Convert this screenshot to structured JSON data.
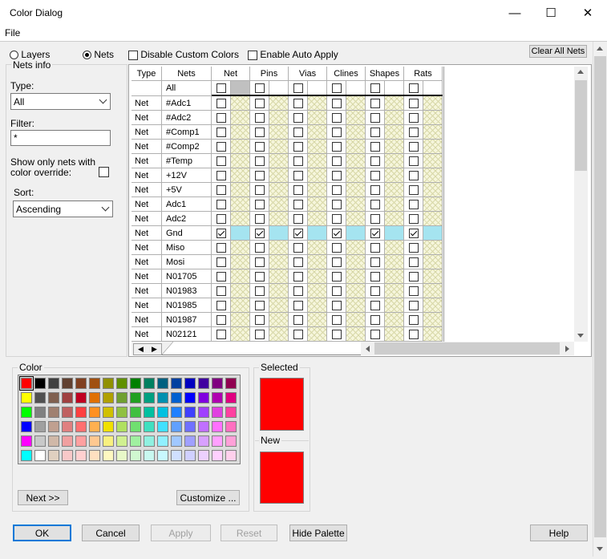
{
  "window": {
    "title": "Color Dialog",
    "minimize_glyph": "—",
    "maximize_glyph": "☐",
    "close_glyph": "✕"
  },
  "menu": {
    "file": "File"
  },
  "mode": {
    "layers": "Layers",
    "nets": "Nets",
    "selected": "nets"
  },
  "options": {
    "disable_custom": "Disable Custom Colors",
    "auto_apply": "Enable Auto Apply",
    "clear_all": "Clear All Nets"
  },
  "nets_info": {
    "legend": "Nets info",
    "type_label": "Type:",
    "type_value": "All",
    "filter_label": "Filter:",
    "filter_value": "*",
    "override_label_1": "Show only nets with",
    "override_label_2": "color override:",
    "sort_label": "Sort:",
    "sort_value": "Ascending"
  },
  "table": {
    "headers": {
      "type": "Type",
      "nets": "Nets",
      "cols": [
        "Net",
        "Pins",
        "Vias",
        "Clines",
        "Shapes",
        "Rats"
      ]
    },
    "all_label": "All",
    "rows": [
      {
        "type": "Net",
        "name": "#Adc1",
        "checked": false
      },
      {
        "type": "Net",
        "name": "#Adc2",
        "checked": false
      },
      {
        "type": "Net",
        "name": "#Comp1",
        "checked": false
      },
      {
        "type": "Net",
        "name": "#Comp2",
        "checked": false
      },
      {
        "type": "Net",
        "name": "#Temp",
        "checked": false
      },
      {
        "type": "Net",
        "name": "+12V",
        "checked": false
      },
      {
        "type": "Net",
        "name": "+5V",
        "checked": false
      },
      {
        "type": "Net",
        "name": "Adc1",
        "checked": false
      },
      {
        "type": "Net",
        "name": "Adc2",
        "checked": false
      },
      {
        "type": "Net",
        "name": "Gnd",
        "checked": true
      },
      {
        "type": "Net",
        "name": "Miso",
        "checked": false
      },
      {
        "type": "Net",
        "name": "Mosi",
        "checked": false
      },
      {
        "type": "Net",
        "name": "N01705",
        "checked": false
      },
      {
        "type": "Net",
        "name": "N01983",
        "checked": false
      },
      {
        "type": "Net",
        "name": "N01985",
        "checked": false
      },
      {
        "type": "Net",
        "name": "N01987",
        "checked": false
      },
      {
        "type": "Net",
        "name": "N02121",
        "checked": false
      }
    ]
  },
  "palette": {
    "legend": "Color",
    "next": "Next >>",
    "customize": "Customize ...",
    "rows": [
      [
        "#ff0000",
        "#000000",
        "#404040",
        "#604030",
        "#804020",
        "#a05010",
        "#909000",
        "#609000",
        "#008000",
        "#008060",
        "#006080",
        "#0040a0",
        "#0000c0",
        "#4000a0",
        "#800080",
        "#900050"
      ],
      [
        "#ffff00",
        "#505050",
        "#806050",
        "#a04040",
        "#c00020",
        "#e07000",
        "#b0a000",
        "#70a030",
        "#20a020",
        "#00a080",
        "#0090b0",
        "#0060d0",
        "#0000ff",
        "#8000e0",
        "#b000b0",
        "#e00080"
      ],
      [
        "#00ff00",
        "#808080",
        "#a08070",
        "#c06060",
        "#ff4040",
        "#ff9020",
        "#d0c000",
        "#90c040",
        "#40c040",
        "#00c0a0",
        "#00c0e0",
        "#2080ff",
        "#4040ff",
        "#a040ff",
        "#e040e0",
        "#ff40a0"
      ],
      [
        "#0000ff",
        "#a0a0a0",
        "#c0a090",
        "#e08080",
        "#ff7070",
        "#ffb050",
        "#f0e000",
        "#b0e060",
        "#70e070",
        "#40e0c0",
        "#40e0ff",
        "#60a0ff",
        "#7070ff",
        "#c070ff",
        "#ff70ff",
        "#ff70c0"
      ],
      [
        "#ff00ff",
        "#c8c8c8",
        "#d0b8a8",
        "#f0a0a0",
        "#ffa0a0",
        "#ffc890",
        "#f8f080",
        "#d0f090",
        "#a0f0a0",
        "#90f0e0",
        "#90f0ff",
        "#a0c8ff",
        "#a0a0ff",
        "#d8a0ff",
        "#ffa0ff",
        "#ffa0d8"
      ],
      [
        "#00ffff",
        "#ffffff",
        "#e0d0c0",
        "#f8c8c8",
        "#ffd0d0",
        "#ffe0c0",
        "#fff8c0",
        "#e8f8c8",
        "#d0f8d0",
        "#c8f8f0",
        "#c8f8ff",
        "#d0e0ff",
        "#d0d0ff",
        "#ecd0ff",
        "#ffd0ff",
        "#ffd0ec"
      ]
    ]
  },
  "preview": {
    "selected_label": "Selected",
    "new_label": "New",
    "selected_color": "#ff0000",
    "new_color": "#ff0000"
  },
  "buttons": {
    "ok": "OK",
    "cancel": "Cancel",
    "apply": "Apply",
    "reset": "Reset",
    "hide_palette": "Hide Palette",
    "help": "Help"
  }
}
